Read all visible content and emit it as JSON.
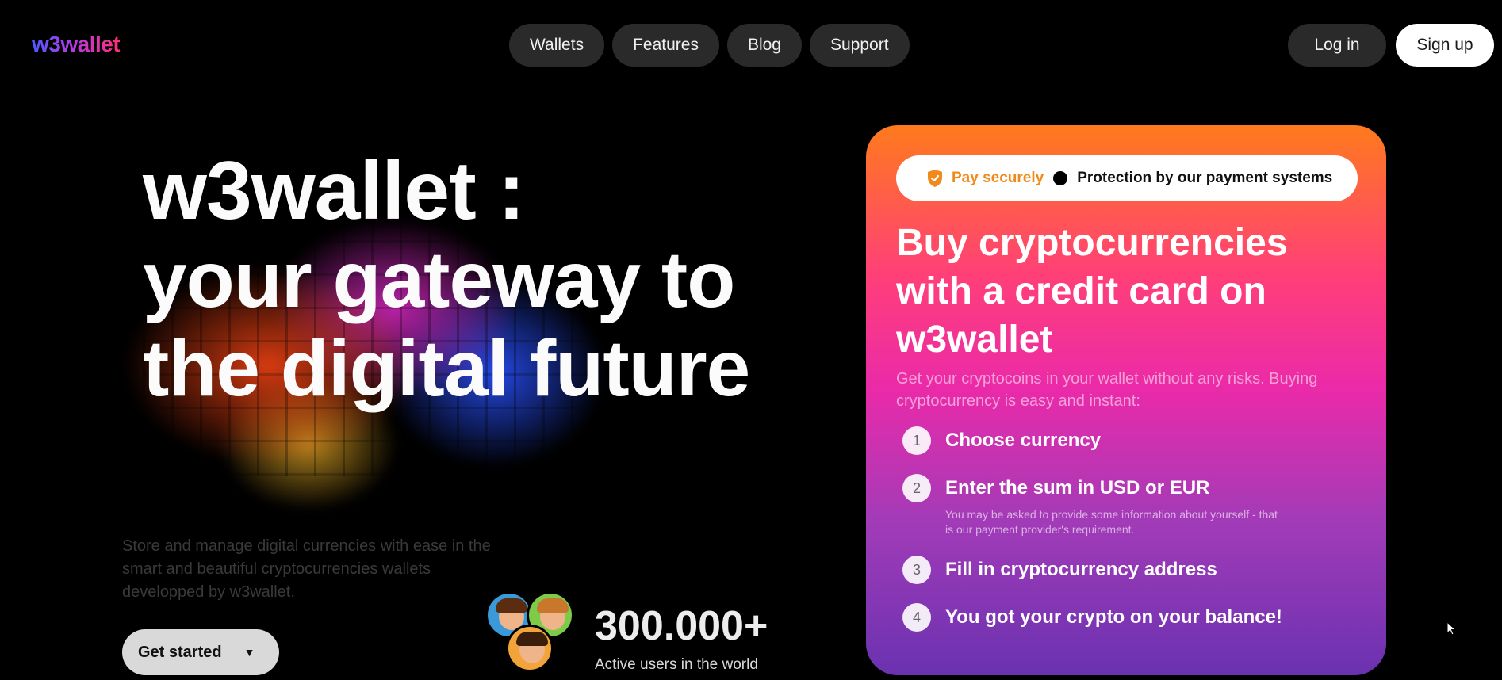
{
  "brand": {
    "logo_text": "w3wallet"
  },
  "nav": {
    "items": [
      {
        "label": "Wallets"
      },
      {
        "label": "Features"
      },
      {
        "label": "Blog"
      },
      {
        "label": "Support"
      }
    ]
  },
  "auth": {
    "login_label": "Log in",
    "signup_label": "Sign up"
  },
  "hero": {
    "title_line1": "w3wallet :",
    "title_line2": "your gateway to",
    "title_line3": "the digital future",
    "description": "Store and manage digital currencies with ease in the smart and beautiful cryptocurrencies wallets developped by w3wallet.",
    "cta_label": "Get started",
    "stat_value": "300.000+",
    "stat_label": "Active users in the world"
  },
  "card": {
    "secure_label": "Pay securely",
    "protection_label": "Protection by our payment systems",
    "title": "Buy cryptocurrencies with a credit card on w3wallet",
    "subtitle": "Get your cryptocoins in your wallet without any risks. Buying cryptocurrency is easy and instant:",
    "steps": [
      {
        "num": "1",
        "text": "Choose currency",
        "note": ""
      },
      {
        "num": "2",
        "text": "Enter the sum in USD or EUR",
        "note": "You may be asked to provide some information about yourself - that is our payment provider's requirement."
      },
      {
        "num": "3",
        "text": "Fill in cryptocurrency address",
        "note": ""
      },
      {
        "num": "4",
        "text": "You got your crypto on your balance!",
        "note": ""
      }
    ]
  },
  "colors": {
    "background": "#000000",
    "pill": "#2a2a2a",
    "card_top": "#ff7a1c",
    "card_mid": "#ea2aa9",
    "card_bottom": "#6a32b0",
    "accent_orange": "#f08a1a"
  },
  "icons": [
    "shield-icon",
    "dot-icon",
    "caret-down-icon",
    "cursor-icon"
  ]
}
